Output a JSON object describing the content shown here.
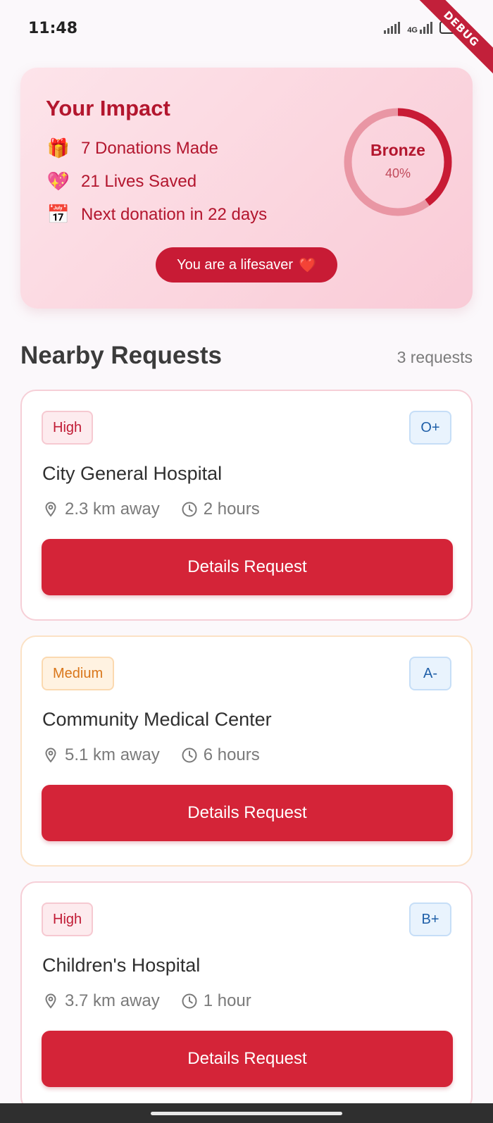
{
  "status_bar": {
    "time": "11:48",
    "network": "4G",
    "battery": "48",
    "debug_label": "DEBUG"
  },
  "impact": {
    "title": "Your Impact",
    "stats": [
      {
        "icon": "gift-icon",
        "emoji": "🎁",
        "text": "7 Donations Made"
      },
      {
        "icon": "sparkling-heart-icon",
        "emoji": "💖",
        "text": "21 Lives Saved"
      },
      {
        "icon": "calendar-icon",
        "emoji": "📅",
        "text": "Next donation in 22 days"
      }
    ],
    "level": "Bronze",
    "progress_text": "40%",
    "progress": 0.4,
    "badge_text": "You are a lifesaver",
    "badge_emoji": "❤️"
  },
  "nearby": {
    "title": "Nearby Requests",
    "count_text": "3 requests",
    "requests": [
      {
        "priority": "High",
        "blood_type": "O+",
        "name": "City General Hospital",
        "distance": "2.3 km away",
        "time": "2 hours",
        "button": "Details Request"
      },
      {
        "priority": "Medium",
        "blood_type": "A-",
        "name": "Community Medical Center",
        "distance": "5.1 km away",
        "time": "6 hours",
        "button": "Details Request"
      },
      {
        "priority": "High",
        "blood_type": "B+",
        "name": "Children's Hospital",
        "distance": "3.7 km away",
        "time": "1 hour",
        "button": "Details Request"
      }
    ]
  },
  "colors": {
    "primary": "#d42438",
    "impact_text": "#b3162e",
    "high_badge": "#c01a34",
    "medium_badge": "#d9761a",
    "blood_badge": "#1f5fa8"
  }
}
